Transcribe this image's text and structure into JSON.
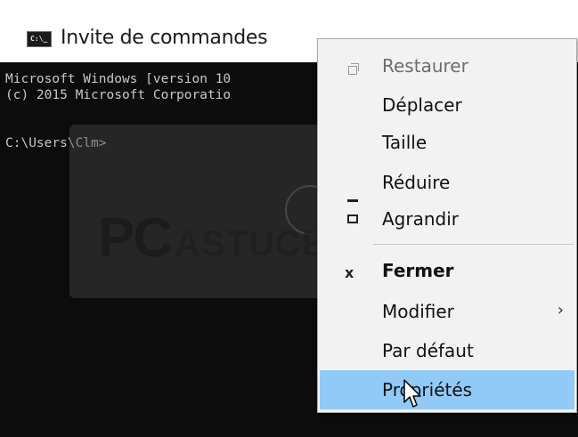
{
  "window": {
    "title": "Invite de commandes",
    "icon": "terminal-icon",
    "icon_glyph": "C:\\_"
  },
  "console": {
    "lines": [
      "Microsoft Windows [version 10",
      "(c) 2015 Microsoft Corporatio",
      "",
      "C:\\Users\\Clm>"
    ]
  },
  "watermark": {
    "brand_pc": "PC",
    "brand_astuces": "ASTUCES"
  },
  "menu": {
    "items": [
      {
        "label": "Restaurer",
        "icon": "restore-icon",
        "disabled": true
      },
      {
        "label": "Déplacer",
        "icon": "",
        "disabled": false
      },
      {
        "label": "Taille",
        "icon": "",
        "disabled": false
      },
      {
        "label": "Réduire",
        "icon": "minimize-icon",
        "disabled": false
      },
      {
        "label": "Agrandir",
        "icon": "maximize-icon",
        "disabled": false
      },
      {
        "label": "Fermer",
        "icon": "close-icon",
        "disabled": false,
        "bold": true
      },
      {
        "label": "Modifier",
        "icon": "",
        "disabled": false,
        "submenu": true
      },
      {
        "label": "Par défaut",
        "icon": "",
        "disabled": false
      },
      {
        "label": "Propriétés",
        "icon": "",
        "disabled": false,
        "highlighted": true
      }
    ],
    "submenu_chevron": "›"
  },
  "colors": {
    "console_bg": "#0c0c0c",
    "console_text": "#c8c8c8",
    "menu_bg": "#f2f2f2",
    "highlight": "#91c9f7"
  }
}
